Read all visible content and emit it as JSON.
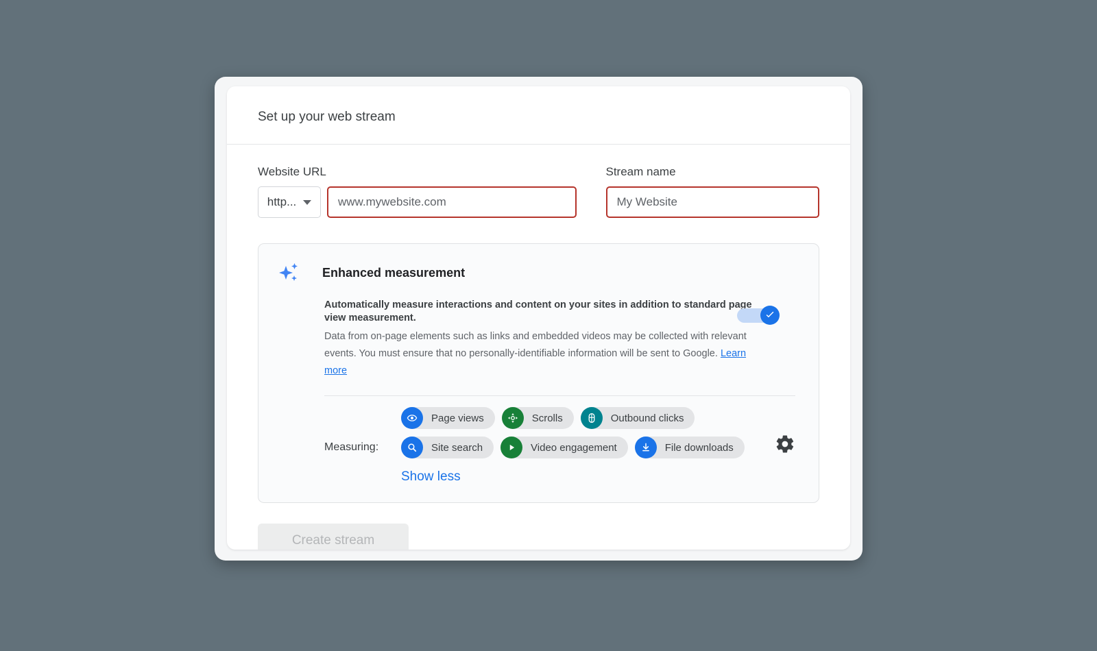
{
  "dialog": {
    "title": "Set up your web stream"
  },
  "form": {
    "url_label": "Website URL",
    "protocol_value": "http...",
    "url_placeholder": "www.mywebsite.com",
    "name_label": "Stream name",
    "name_placeholder": "My Website"
  },
  "enhanced_measurement": {
    "title": "Enhanced measurement",
    "headline": "Automatically measure interactions and content on your sites in addition to standard page view measurement.",
    "description": "Data from on-page elements such as links and embedded videos may be collected with relevant events. You must ensure that no personally-identifiable information will be sent to Google.",
    "learn_more": "Learn more",
    "toggle_state": "on",
    "measuring_label": "Measuring:",
    "show_less": "Show less",
    "chips_row1": [
      {
        "label": "Page views",
        "icon": "eye-icon",
        "color": "#1a73e8"
      },
      {
        "label": "Scrolls",
        "icon": "scroll-move-icon",
        "color": "#188038"
      },
      {
        "label": "Outbound clicks",
        "icon": "mouse-icon",
        "color": "#00838f"
      }
    ],
    "chips_row2": [
      {
        "label": "Site search",
        "icon": "search-icon",
        "color": "#1a73e8"
      },
      {
        "label": "Video engagement",
        "icon": "play-icon",
        "color": "#188038"
      },
      {
        "label": "File downloads",
        "icon": "download-icon",
        "color": "#1a73e8"
      }
    ],
    "settings_icon": "gear-icon"
  },
  "footer": {
    "create_button": "Create stream"
  },
  "colors": {
    "page_background": "#62717a",
    "accent_blue": "#1a73e8",
    "error_red": "#b5342b",
    "panel_background": "#fafbfc"
  }
}
